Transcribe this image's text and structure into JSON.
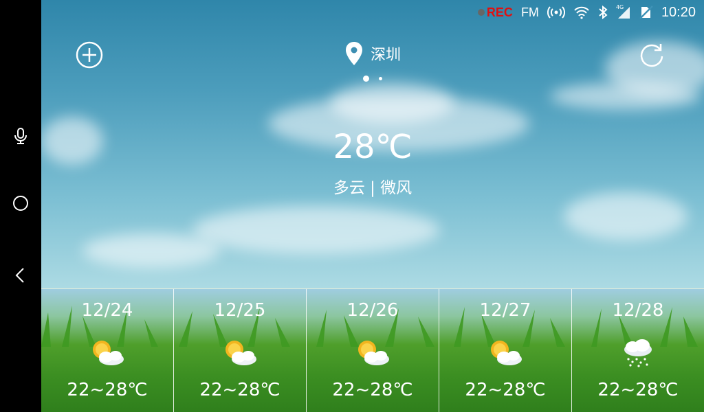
{
  "statusbar": {
    "rec_label": "REC",
    "fm_label": "FM",
    "network_label": "4G",
    "time": "10:20"
  },
  "location": {
    "city": "深圳"
  },
  "current": {
    "temperature": "28℃",
    "condition": "多云 | 微风"
  },
  "forecast": [
    {
      "date": "12/24",
      "icon": "partly-cloudy-icon",
      "range": "22~28℃"
    },
    {
      "date": "12/25",
      "icon": "partly-cloudy-icon",
      "range": "22~28℃"
    },
    {
      "date": "12/26",
      "icon": "partly-cloudy-icon",
      "range": "22~28℃"
    },
    {
      "date": "12/27",
      "icon": "partly-cloudy-icon",
      "range": "22~28℃"
    },
    {
      "date": "12/28",
      "icon": "snow-cloud-icon",
      "range": "22~28℃"
    }
  ],
  "colors": {
    "rec": "#e01010",
    "text": "#ffffff"
  }
}
